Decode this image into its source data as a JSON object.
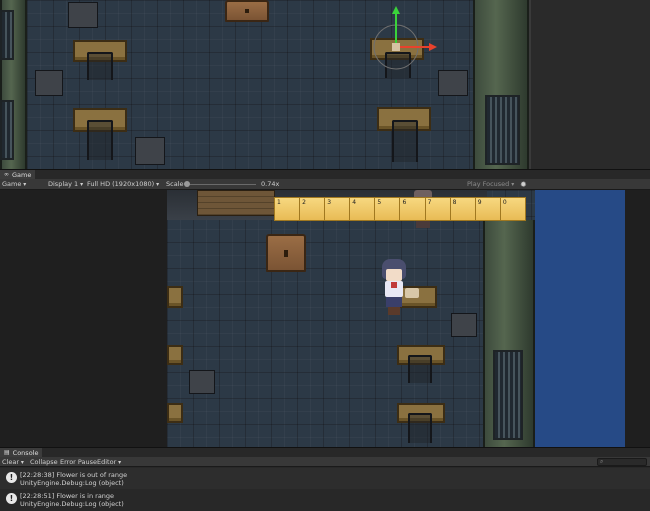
{
  "game_panel": {
    "tab_label": "Game",
    "toolbar": {
      "mode": "Game",
      "display": "Display 1",
      "resolution": "Full HD (1920x1080)",
      "scale_label": "Scale",
      "scale_value": "0.74x",
      "play_mode": "Play Focused"
    }
  },
  "inventory": {
    "slots": [
      "1",
      "2",
      "3",
      "4",
      "5",
      "6",
      "7",
      "8",
      "9",
      "0"
    ]
  },
  "console_panel": {
    "tab_label": "Console",
    "toolbar": {
      "clear": "Clear",
      "collapse": "Collapse",
      "error_pause": "Error Pause",
      "editor": "Editor"
    },
    "logs": [
      {
        "icon": "info-icon",
        "line1": "[22:28:38] Flower is out of range",
        "line2": "UnityEngine.Debug:Log (object)"
      },
      {
        "icon": "info-icon",
        "line1": "[22:28:51] Flower is in range",
        "line2": "UnityEngine.Debug:Log (object)"
      }
    ]
  },
  "colors": {
    "editor_dark": "#1b1b1b",
    "toolbar": "#383838",
    "floor": "#2c3946",
    "game_blue": "#264a86",
    "inventory_slot": "#f0c86a",
    "gizmo_y": "#3ad33a",
    "gizmo_x": "#e8422c"
  }
}
